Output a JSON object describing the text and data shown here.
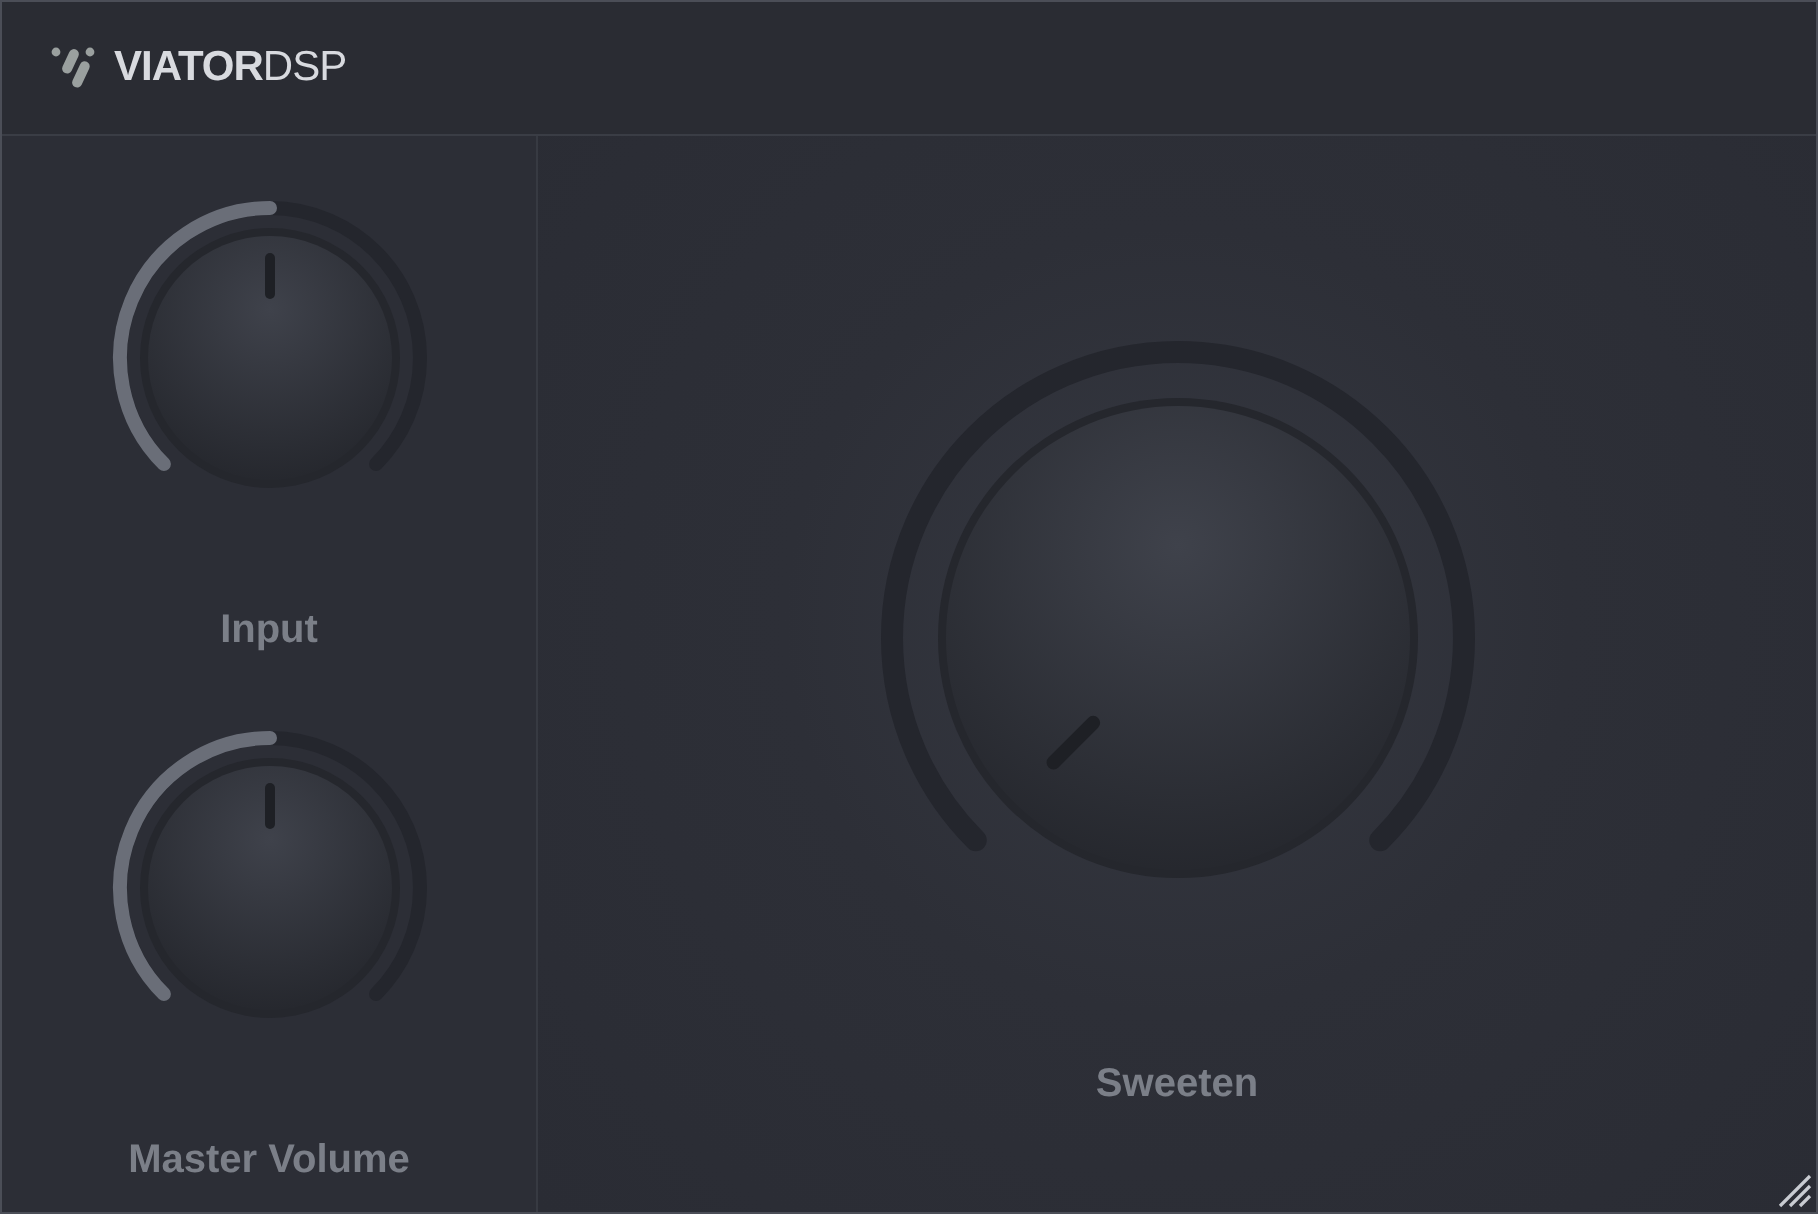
{
  "header": {
    "logo": "**VIATOR**DSP"
  },
  "knobs": [
    {
      "kind": "small",
      "label": "Input"
    },
    {
      "kind": "small",
      "label": "Master Volume"
    },
    {
      "kind": "large",
      "label": "Sweeten"
    }
  ]
}
